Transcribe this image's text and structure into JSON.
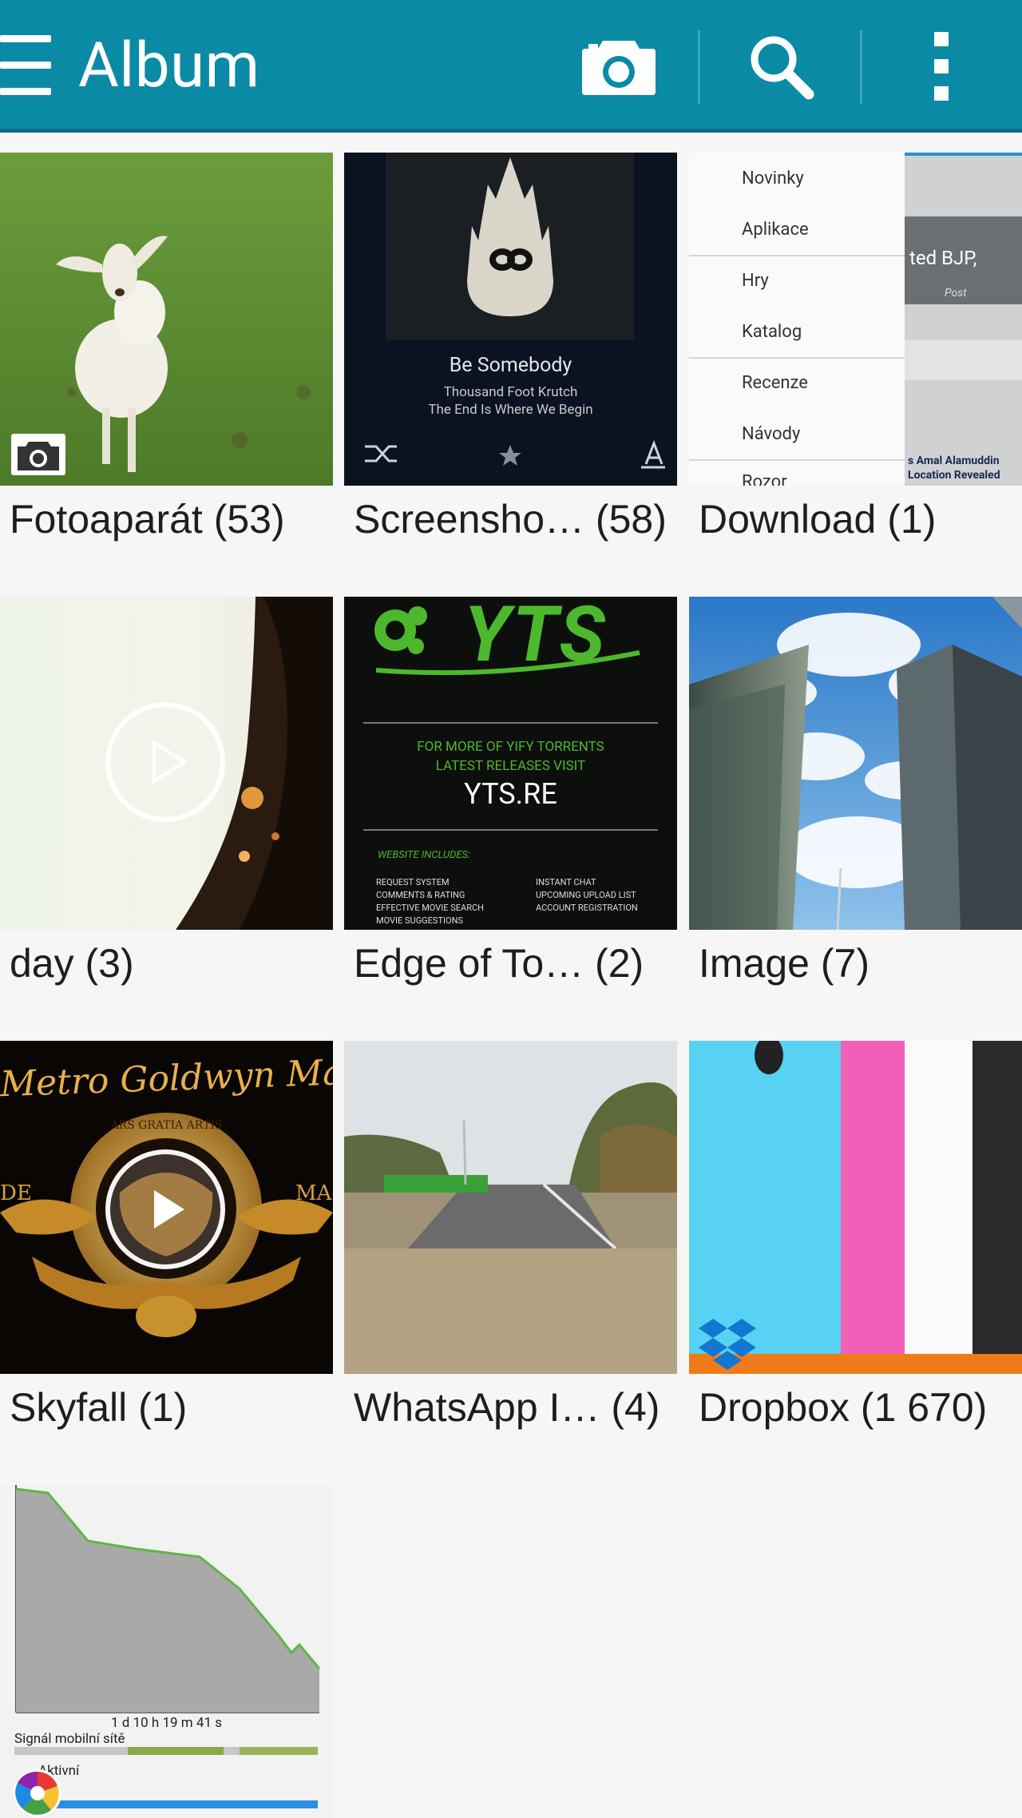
{
  "appbar": {
    "title": "Album",
    "background": "#0b8aa6",
    "icons": [
      "menu-icon",
      "camera-icon",
      "search-icon",
      "more-vert-icon"
    ]
  },
  "albums": [
    {
      "label": "Fotoaparát (53)"
    },
    {
      "label": "Screensho… (58)"
    },
    {
      "label": "Download (1)"
    },
    {
      "label": "day (3)"
    },
    {
      "label": "Edge of To… (2)"
    },
    {
      "label": "Image (7)"
    },
    {
      "label": "Skyfall (1)"
    },
    {
      "label": "WhatsApp I… (4)"
    },
    {
      "label": "Dropbox (1 670)"
    },
    {
      "label": ""
    }
  ],
  "thumbs": {
    "screenshot": {
      "song": "Be Somebody",
      "artist": "Thousand Foot Krutch",
      "album": "The End Is Where We Begin"
    },
    "download_menu": [
      "Novinky",
      "Aplikace",
      "Hry",
      "Katalog",
      "Recenze",
      "Návody",
      "Rozor"
    ],
    "download_side": {
      "headline": "ted BJP,",
      "meta": "Post",
      "caption1": "s Amal Alamuddin",
      "caption2": "Location Revealed"
    },
    "yts": {
      "logo": "YTS",
      "line1": "FOR MORE OF YIFY TORRENTS",
      "line2": "LATEST RELEASES VISIT",
      "url": "YTS.RE",
      "includes": "WEBSITE INCLUDES:",
      "left_items": [
        "REQUEST SYSTEM",
        "COMMENTS & RATING",
        "EFFECTIVE MOVIE SEARCH",
        "MOVIE SUGGESTIONS"
      ],
      "right_items": [
        "INSTANT CHAT",
        "UPCOMING UPLOAD LIST",
        "ACCOUNT REGISTRATION"
      ]
    },
    "mgm": {
      "top": "Metro Goldwyn Mayer",
      "left": "DE",
      "right": "MA",
      "ribbon": "ARS GRATIA ARTIS"
    },
    "battery": {
      "duration": "1 d 10 h 19 m 41 s",
      "signal": "Signál mobilní sítě",
      "active": "Aktivní"
    }
  }
}
